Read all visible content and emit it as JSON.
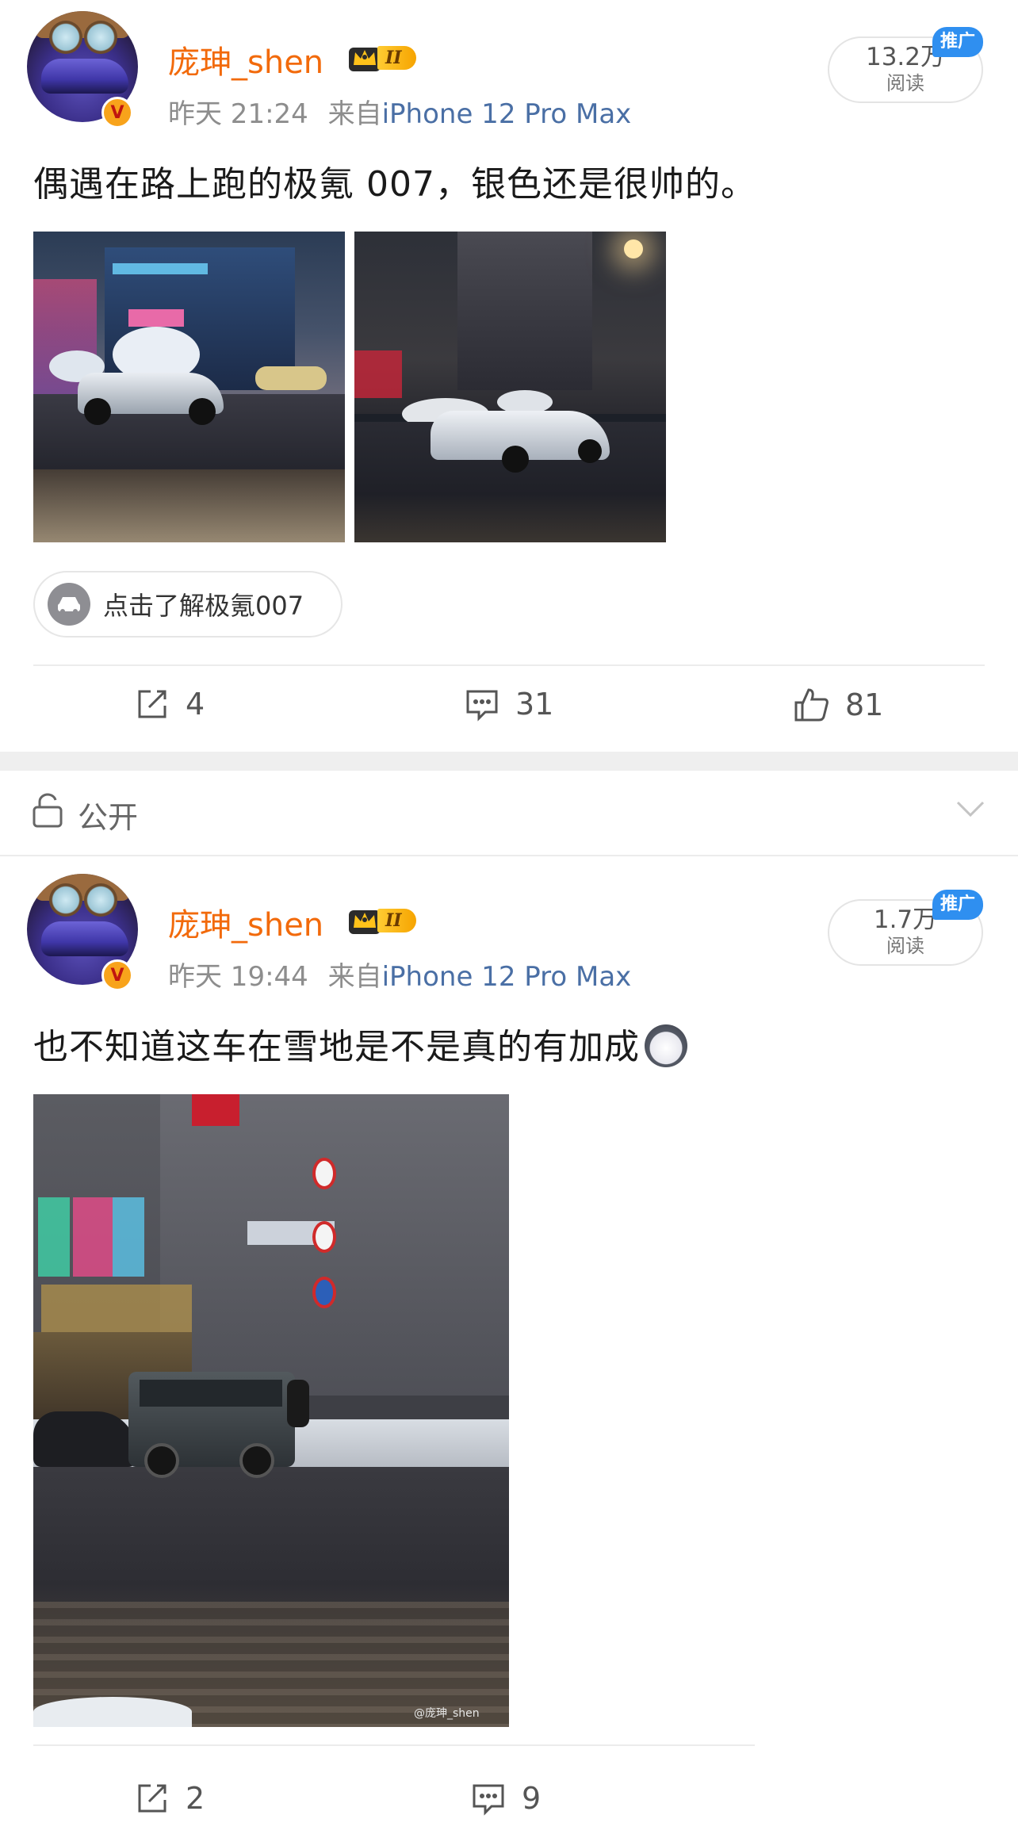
{
  "posts": [
    {
      "username": "庞珅_shen",
      "vip_level": "II",
      "time": "昨天 21:24",
      "source_prefix": "来自",
      "device": "iPhone 12 Pro Max",
      "reads_count": "13.2万",
      "reads_label": "阅读",
      "promo_tag": "推广",
      "text": "偶遇在路上跑的极氪 007，银色还是很帅的。",
      "link_chip": "点击了解极氪007",
      "actions": {
        "reposts": "4",
        "comments": "31",
        "likes": "81"
      }
    },
    {
      "username": "庞珅_shen",
      "vip_level": "II",
      "time": "昨天 19:44",
      "source_prefix": "来自",
      "device": "iPhone 12 Pro Max",
      "reads_count": "1.7万",
      "reads_label": "阅读",
      "promo_tag": "推广",
      "text": "也不知道这车在雪地是不是真的有加成",
      "watermark": "@庞珅_shen",
      "actions": {
        "reposts": "2",
        "comments": "9"
      }
    }
  ],
  "privacy": {
    "label": "公开"
  },
  "colors": {
    "username": "#f26a0b",
    "device": "#4a6fa5",
    "promo": "#2f8ff0",
    "vbadge": "#f8a31b"
  },
  "icons": [
    "verified-v-icon",
    "crown-icon",
    "car-icon",
    "repost-icon",
    "comment-icon",
    "like-icon",
    "lock-icon",
    "chevron-down-icon",
    "emoji-husky-icon"
  ]
}
